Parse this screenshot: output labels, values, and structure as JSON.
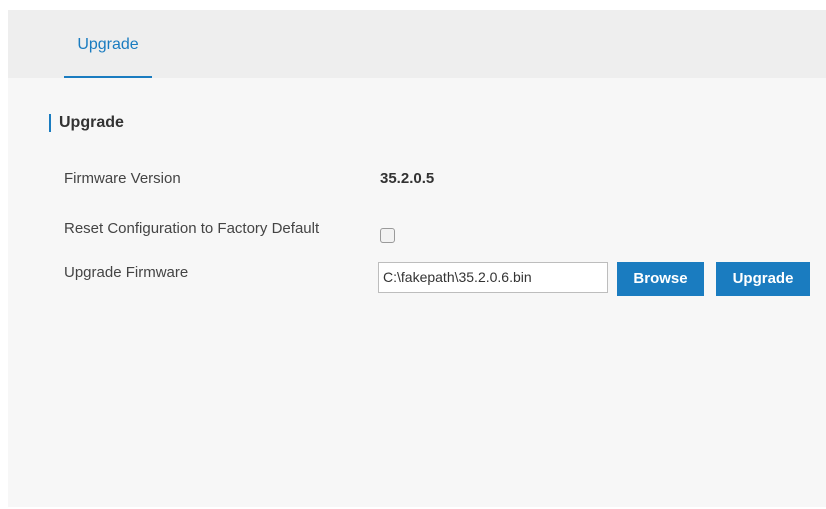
{
  "tabs": [
    {
      "label": "Upgrade",
      "active": true
    }
  ],
  "section": {
    "title": "Upgrade"
  },
  "form": {
    "firmware_version_label": "Firmware Version",
    "firmware_version_value": "35.2.0.5",
    "reset_label": "Reset Configuration to Factory Default",
    "reset_checked": false,
    "upgrade_firmware_label": "Upgrade Firmware",
    "file_path": "C:\\fakepath\\35.2.0.6.bin",
    "browse_label": "Browse",
    "upgrade_label": "Upgrade"
  },
  "colors": {
    "accent": "#1a7cc0",
    "tabbar_bg": "#eeeeee",
    "panel_bg": "#f7f7f7"
  }
}
